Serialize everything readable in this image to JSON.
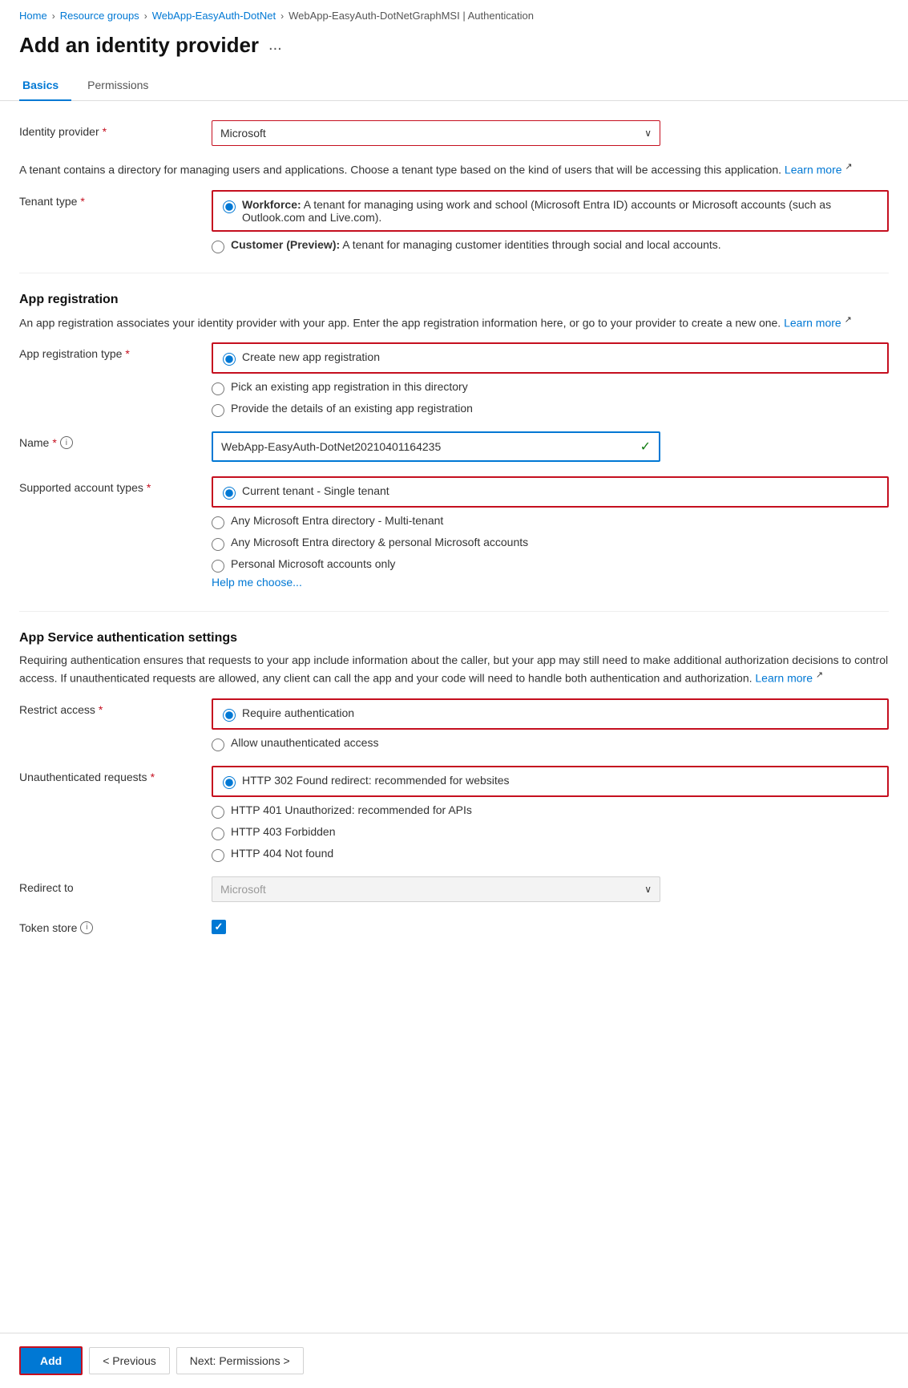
{
  "breadcrumb": {
    "items": [
      {
        "label": "Home",
        "sep": true
      },
      {
        "label": "Resource groups",
        "sep": true
      },
      {
        "label": "WebApp-EasyAuth-DotNet",
        "sep": true
      },
      {
        "label": "WebApp-EasyAuth-DotNetGraphMSI | Authentication",
        "sep": false
      }
    ]
  },
  "page": {
    "title": "Add an identity provider",
    "menu_icon": "...",
    "tabs": [
      {
        "label": "Basics",
        "active": true
      },
      {
        "label": "Permissions",
        "active": false
      }
    ]
  },
  "identity_provider": {
    "label": "Identity provider",
    "required": true,
    "value": "Microsoft"
  },
  "tenant_description": "A tenant contains a directory for managing users and applications. Choose a tenant type based on the kind of users that will be accessing this application.",
  "learn_more_label": "Learn more",
  "tenant_type": {
    "label": "Tenant type",
    "required": true,
    "options": [
      {
        "value": "workforce",
        "label_bold": "Workforce:",
        "label_rest": " A tenant for managing using work and school (Microsoft Entra ID) accounts or Microsoft accounts (such as Outlook.com and Live.com).",
        "selected": true,
        "bordered": true
      },
      {
        "value": "customer",
        "label_bold": "Customer (Preview):",
        "label_rest": " A tenant for managing customer identities through social and local accounts.",
        "selected": false
      }
    ]
  },
  "app_registration": {
    "section_title": "App registration",
    "description": "An app registration associates your identity provider with your app. Enter the app registration information here, or go to your provider to create a new one.",
    "learn_more_label": "Learn more",
    "type_field": {
      "label": "App registration type",
      "required": true,
      "options": [
        {
          "value": "create_new",
          "label": "Create new app registration",
          "selected": true,
          "bordered": true
        },
        {
          "value": "pick_existing",
          "label": "Pick an existing app registration in this directory",
          "selected": false
        },
        {
          "value": "provide_details",
          "label": "Provide the details of an existing app registration",
          "selected": false
        }
      ]
    },
    "name_field": {
      "label": "Name",
      "required": true,
      "value": "WebApp-EasyAuth-DotNet20210401164235",
      "check_icon": "✓"
    },
    "account_types_field": {
      "label": "Supported account types",
      "required": true,
      "options": [
        {
          "value": "single_tenant",
          "label": "Current tenant - Single tenant",
          "selected": true,
          "bordered": true
        },
        {
          "value": "multi_tenant",
          "label": "Any Microsoft Entra directory - Multi-tenant",
          "selected": false
        },
        {
          "value": "multi_personal",
          "label": "Any Microsoft Entra directory & personal Microsoft accounts",
          "selected": false
        },
        {
          "value": "personal_only",
          "label": "Personal Microsoft accounts only",
          "selected": false
        }
      ],
      "help_link": "Help me choose..."
    }
  },
  "app_service_auth": {
    "section_title": "App Service authentication settings",
    "description": "Requiring authentication ensures that requests to your app include information about the caller, but your app may still need to make additional authorization decisions to control access. If unauthenticated requests are allowed, any client can call the app and your code will need to handle both authentication and authorization.",
    "learn_more_label": "Learn more",
    "restrict_access": {
      "label": "Restrict access",
      "required": true,
      "options": [
        {
          "value": "require_auth",
          "label": "Require authentication",
          "selected": true,
          "bordered": true
        },
        {
          "value": "allow_unauth",
          "label": "Allow unauthenticated access",
          "selected": false
        }
      ]
    },
    "unauthenticated_requests": {
      "label": "Unauthenticated requests",
      "required": true,
      "options": [
        {
          "value": "http302",
          "label": "HTTP 302 Found redirect: recommended for websites",
          "selected": true,
          "bordered": true
        },
        {
          "value": "http401",
          "label": "HTTP 401 Unauthorized: recommended for APIs",
          "selected": false
        },
        {
          "value": "http403",
          "label": "HTTP 403 Forbidden",
          "selected": false
        },
        {
          "value": "http404",
          "label": "HTTP 404 Not found",
          "selected": false
        }
      ]
    },
    "redirect_to": {
      "label": "Redirect to",
      "value": "Microsoft",
      "placeholder": "Microsoft"
    },
    "token_store": {
      "label": "Token store",
      "checked": true
    }
  },
  "footer": {
    "add_label": "Add",
    "previous_label": "< Previous",
    "next_label": "Next: Permissions >"
  }
}
